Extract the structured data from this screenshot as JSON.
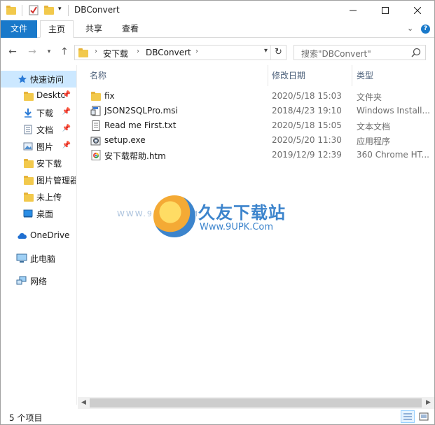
{
  "window": {
    "title": "DBConvert"
  },
  "ribbon": {
    "tabs": [
      "文件",
      "主页",
      "共享",
      "查看"
    ],
    "active_tab": "主页",
    "file_tab_color": "#1979ca"
  },
  "address": {
    "crumbs": [
      "安下载",
      "DBConvert"
    ],
    "search_placeholder": "搜索\"DBConvert\""
  },
  "nav": {
    "quick_access": "快速访问",
    "items": [
      {
        "label": "Desktc",
        "icon": "folder-icon",
        "pinned": true
      },
      {
        "label": "下载",
        "icon": "download-icon",
        "pinned": true
      },
      {
        "label": "文档",
        "icon": "document-icon",
        "pinned": true
      },
      {
        "label": "图片",
        "icon": "picture-icon",
        "pinned": true
      },
      {
        "label": "安下载",
        "icon": "folder-icon",
        "pinned": false
      },
      {
        "label": "图片管理器",
        "icon": "folder-icon",
        "pinned": false
      },
      {
        "label": "未上传",
        "icon": "folder-icon",
        "pinned": false
      },
      {
        "label": "桌面",
        "icon": "desktop-icon",
        "pinned": false
      }
    ],
    "onedrive": "OneDrive",
    "this_pc": "此电脑",
    "network": "网络"
  },
  "columns": {
    "name": "名称",
    "date": "修改日期",
    "type": "类型"
  },
  "files": [
    {
      "name": "fix",
      "date": "2020/5/18 15:03",
      "type": "文件夹",
      "icon": "folder-icon"
    },
    {
      "name": "JSON2SQLPro.msi",
      "date": "2018/4/23 19:10",
      "type": "Windows Install...",
      "icon": "msi-icon"
    },
    {
      "name": "Read me First.txt",
      "date": "2020/5/18 15:05",
      "type": "文本文档",
      "icon": "text-file-icon"
    },
    {
      "name": "setup.exe",
      "date": "2020/5/20 11:30",
      "type": "应用程序",
      "icon": "setup-icon"
    },
    {
      "name": "安下载帮助.htm",
      "date": "2019/12/9 12:39",
      "type": "360 Chrome HT...",
      "icon": "browser-icon"
    }
  ],
  "watermark": {
    "brand": "久友下载站",
    "url": "Www.9UPK.Com",
    "faint": "WWW.9UPK.COM"
  },
  "status": {
    "item_count": "5 个项目"
  }
}
